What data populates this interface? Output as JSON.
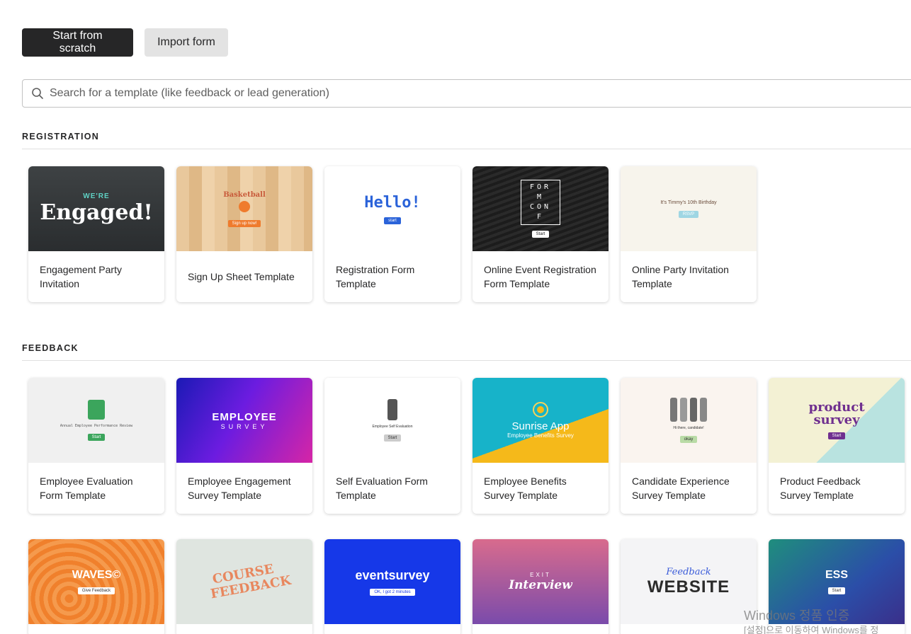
{
  "actions": {
    "start_label": "Start from scratch",
    "import_label": "Import form"
  },
  "search": {
    "placeholder": "Search for a template (like feedback or lead generation)"
  },
  "sections": {
    "registration": {
      "title": "REGISTRATION",
      "cards": [
        {
          "label": "Engagement Party Invitation",
          "thumb_text": "Engaged!",
          "thumb_sub": "WE'RE"
        },
        {
          "label": "Sign Up Sheet Template",
          "thumb_text": "Basketball",
          "thumb_sub": "Sign up now!"
        },
        {
          "label": "Registration Form Template",
          "thumb_text": "Hello!",
          "thumb_sub": "start"
        },
        {
          "label": "Online Event Registration Form Template",
          "thumb_text": "FORM CONF",
          "thumb_sub": "Start"
        },
        {
          "label": "Online Party Invitation Template",
          "thumb_text": "It's Timmy's 10th Birthday",
          "thumb_sub": "RSVP"
        }
      ]
    },
    "feedback": {
      "title": "FEEDBACK",
      "cards": [
        {
          "label": "Employee Evaluation Form Template",
          "thumb_text": "Annual Employee Performance Review",
          "thumb_sub": "Start"
        },
        {
          "label": "Employee Engagement Survey Template",
          "thumb_text": "EMPLOYEE",
          "thumb_sub": "SURVEY"
        },
        {
          "label": "Self Evaluation Form Template",
          "thumb_text": "Employee Self Evaluation",
          "thumb_sub": "Start"
        },
        {
          "label": "Employee Benefits Survey Template",
          "thumb_text": "Sunrise App",
          "thumb_sub": "Employee Benefits Survey"
        },
        {
          "label": "Candidate Experience Survey Template",
          "thumb_text": "Hi there, candidate!",
          "thumb_sub": "okay"
        },
        {
          "label": "Product Feedback Survey Template",
          "thumb_text": "product survey",
          "thumb_sub": "Start"
        }
      ]
    },
    "third_row": {
      "cards": [
        {
          "thumb_text": "WAVES©",
          "thumb_sub": "Give Feedback"
        },
        {
          "thumb_text": "COURSE FEEDBACK",
          "thumb_sub": ""
        },
        {
          "thumb_text": "eventsurvey",
          "thumb_sub": "OK, I got 2 minutes"
        },
        {
          "thumb_text": "Interview",
          "thumb_sub": "EXIT"
        },
        {
          "thumb_text": "WEBSITE",
          "thumb_sub": "Feedback"
        },
        {
          "thumb_text": "ESS",
          "thumb_sub": "Start"
        }
      ]
    }
  },
  "watermark": {
    "line1": "Windows 정품 인증",
    "line2": "[설정]으로 이동하여 Windows를 정"
  }
}
